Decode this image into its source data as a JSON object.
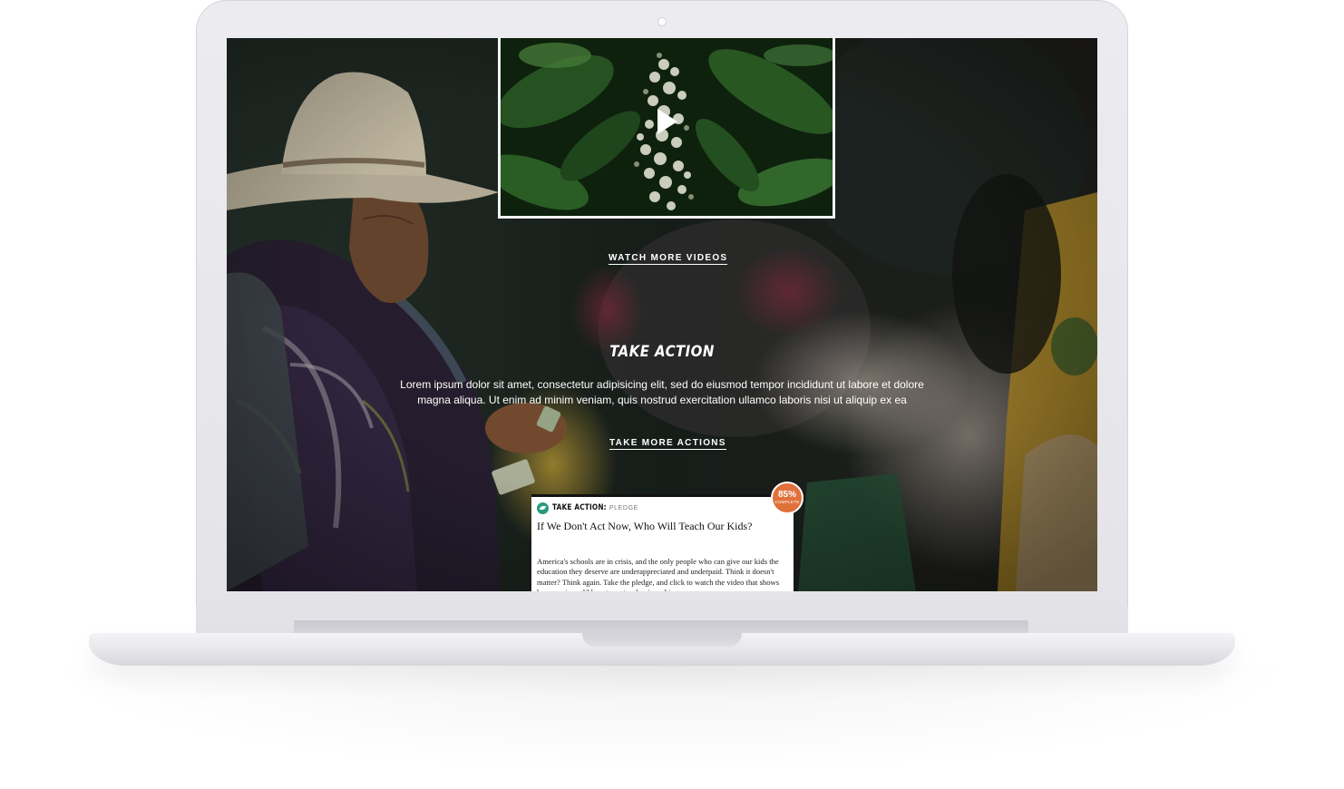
{
  "video": {
    "play_icon": "play-icon"
  },
  "videos_section": {
    "watch_more_label": "WATCH MORE VIDEOS"
  },
  "take_action_section": {
    "title": "TAKE ACTION",
    "body": "Lorem ipsum dolor sit amet, consectetur adipisicing elit, sed do eiusmod tempor incididunt ut labore et dolore magna aliqua. Ut enim ad minim veniam, quis nostrud exercitation ullamco laboris nisi ut aliquip ex ea",
    "take_more_label": "TAKE MORE ACTIONS"
  },
  "action_card": {
    "icon": "leaf-icon",
    "label": "TAKE ACTION:",
    "kind": "PLEDGE",
    "title": "If We Don't Act Now, Who Will Teach Our Kids?",
    "text": "America's schools are in crisis, and the only people who can give our kids the education they deserve are underappreciated and underpaid. Think it doesn't matter? Think again. Take the pledge, and click to watch the video that shows how one incredible veteran teacher is making a",
    "progress_percent": "85%",
    "progress_label": "COMPLETE",
    "progress_color": "#e0703c",
    "accent_color": "#2a9a7c"
  }
}
